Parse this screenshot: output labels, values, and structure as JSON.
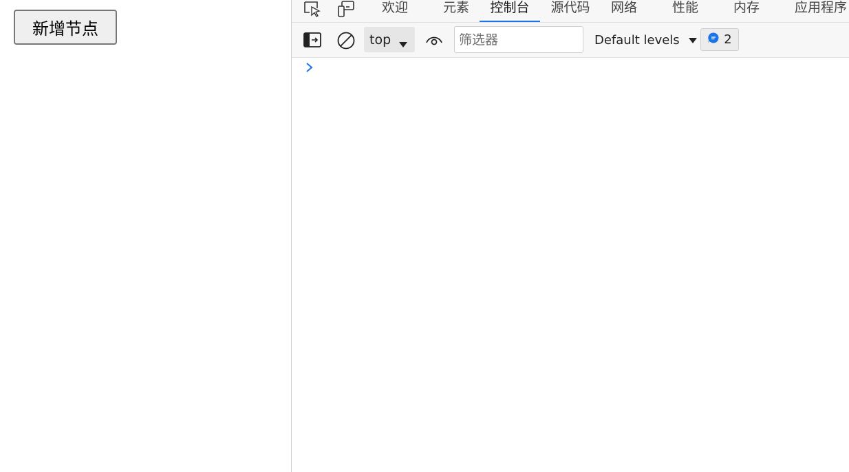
{
  "page": {
    "add_node_button": "新增节点"
  },
  "devtools": {
    "tabs": [
      {
        "label": "欢迎"
      },
      {
        "label": "元素"
      },
      {
        "label": "控制台",
        "active": true
      },
      {
        "label": "源代码"
      },
      {
        "label": "网络"
      },
      {
        "label": "性能"
      },
      {
        "label": "内存"
      },
      {
        "label": "应用程序"
      }
    ],
    "toolbar": {
      "context": "top",
      "filter_placeholder": "筛选器",
      "levels_label": "Default levels",
      "issues_count": "2"
    },
    "icons": [
      "inspect-icon",
      "device-toggle-icon",
      "sidebar-toggle-icon",
      "clear-console-icon",
      "eye-icon",
      "caret-down-icon",
      "message-icon",
      "prompt-chevron-icon"
    ],
    "colors": {
      "accent": "#1a73e8",
      "toolbar_bg": "#f7f7f7"
    }
  }
}
